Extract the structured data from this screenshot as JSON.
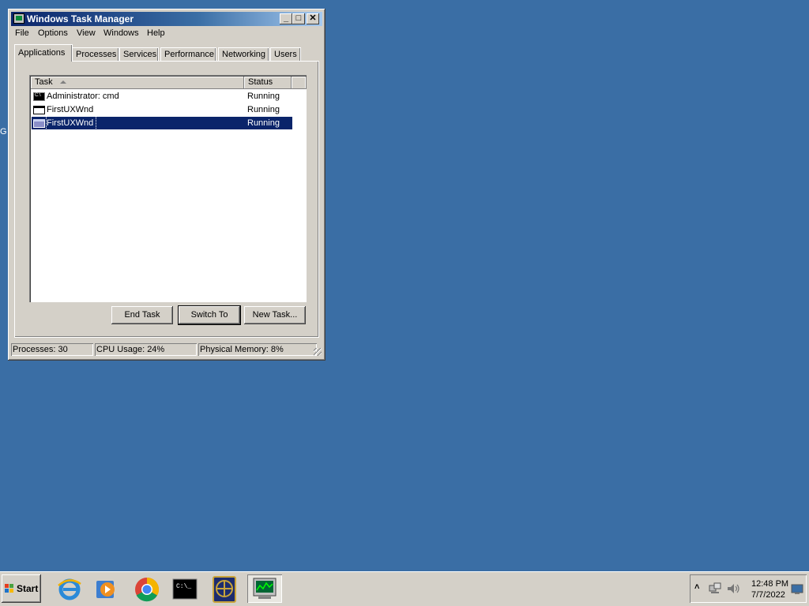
{
  "desktop": {
    "edge_text": "G"
  },
  "window": {
    "title": "Windows Task Manager",
    "controls": {
      "minimize": "_",
      "maximize": "□",
      "close": "✕"
    }
  },
  "menu": [
    "File",
    "Options",
    "View",
    "Windows",
    "Help"
  ],
  "tabs": [
    "Applications",
    "Processes",
    "Services",
    "Performance",
    "Networking",
    "Users"
  ],
  "active_tab": "Applications",
  "table": {
    "columns": [
      "Task",
      "Status"
    ],
    "rows": [
      {
        "task": "Administrator: cmd",
        "status": "Running",
        "icon": "cmd-icon"
      },
      {
        "task": "FirstUXWnd",
        "status": "Running",
        "icon": "window-icon"
      },
      {
        "task": "FirstUXWnd",
        "status": "Running",
        "icon": "window-icon",
        "selected": true
      }
    ]
  },
  "buttons": {
    "end_task": "End Task",
    "switch_to": "Switch To",
    "new_task": "New Task..."
  },
  "status_bar": {
    "processes": "Processes: 30",
    "cpu": "CPU Usage: 24%",
    "memory": "Physical Memory: 8%"
  },
  "taskbar": {
    "start_label": "Start",
    "pinned": [
      "internet-explorer-icon",
      "media-player-icon",
      "chrome-icon",
      "cmd-icon",
      "app-icon",
      "task-manager-icon"
    ],
    "clock": {
      "time": "12:48 PM",
      "date": "7/7/2022"
    }
  },
  "colors": {
    "desktop": "#3a6ea5",
    "titlebar": "#0a246a",
    "selection": "#0a246a",
    "face": "#d4d0c8"
  }
}
